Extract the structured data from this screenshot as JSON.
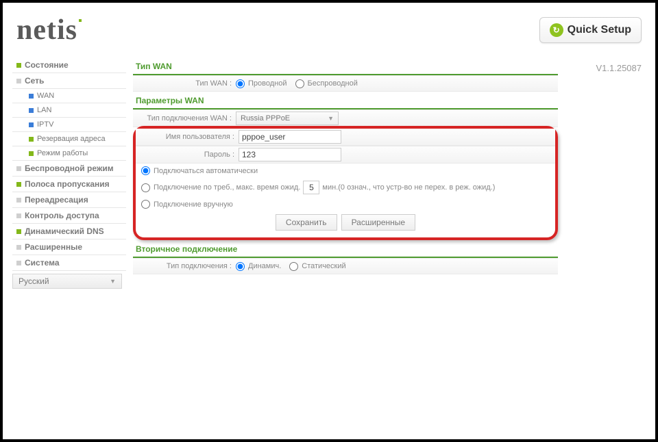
{
  "header": {
    "logo": "netis",
    "quick_setup": "Quick Setup",
    "version": "V1.1.25087"
  },
  "sidebar": {
    "items": [
      {
        "label": "Состояние",
        "type": "top",
        "sq": "green"
      },
      {
        "label": "Сеть",
        "type": "top",
        "sq": "grey"
      },
      {
        "label": "WAN",
        "type": "sub",
        "sq": "blue"
      },
      {
        "label": "LAN",
        "type": "sub",
        "sq": "blue"
      },
      {
        "label": "IPTV",
        "type": "sub",
        "sq": "blue"
      },
      {
        "label": "Резервация адреса",
        "type": "sub",
        "sq": "green"
      },
      {
        "label": "Режим работы",
        "type": "sub",
        "sq": "green"
      },
      {
        "label": "Беспроводной режим",
        "type": "top",
        "sq": "grey"
      },
      {
        "label": "Полоса пропускания",
        "type": "top",
        "sq": "green"
      },
      {
        "label": "Переадресация",
        "type": "top",
        "sq": "grey"
      },
      {
        "label": "Контроль доступа",
        "type": "top",
        "sq": "grey"
      },
      {
        "label": "Динамический DNS",
        "type": "top",
        "sq": "green"
      },
      {
        "label": "Расширенные",
        "type": "top",
        "sq": "grey"
      },
      {
        "label": "Система",
        "type": "top",
        "sq": "grey"
      }
    ],
    "language": "Русский"
  },
  "sections": {
    "wan_type_title": "Тип WAN",
    "wan_type_label": "Тип WAN :",
    "wan_type_wired": "Проводной",
    "wan_type_wireless": "Беспроводной",
    "wan_params_title": "Параметры WAN",
    "conn_type_label": "Тип подключения WAN :",
    "conn_type_value": "Russia PPPoE",
    "username_label": "Имя пользователя :",
    "username_value": "pppoe_user",
    "password_label": "Пароль :",
    "password_value": "123",
    "mode_auto": "Подключаться автоматически",
    "mode_demand_pre": "Подключение по треб., макс. время ожид.",
    "mode_demand_val": "5",
    "mode_demand_post": "мин.(0 означ., что устр-во не перех. в реж. ожид.)",
    "mode_manual": "Подключение вручную",
    "save_btn": "Сохранить",
    "advanced_btn": "Расширенные",
    "secondary_title": "Вторичное подключение",
    "sec_conn_label": "Тип подключения :",
    "sec_dynamic": "Динамич.",
    "sec_static": "Статический"
  }
}
